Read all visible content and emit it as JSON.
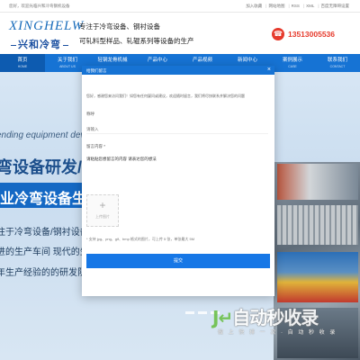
{
  "topbar": {
    "welcome": "您好，欢迎光临兴和冷弯钢机设备",
    "links": [
      "加入收藏",
      "网站地图",
      "RSS",
      "XML",
      "百度无障碍设置"
    ]
  },
  "header": {
    "logo_en": "XINGHELW",
    "logo_cn": "兴和冷弯",
    "slogan1": "专注于冷弯设备、钢衬设备",
    "slogan2": "可轧料型样品、轧辊系列等设备的生产",
    "phone": "13513005536",
    "phone_icon": "phone-icon"
  },
  "nav": [
    {
      "cn": "首页",
      "en": "HOME"
    },
    {
      "cn": "关于我们",
      "en": "ABOUT US"
    },
    {
      "cn": "轻钢龙骨机械",
      "en": ""
    },
    {
      "cn": "产品中心",
      "en": ""
    },
    {
      "cn": "产品视频",
      "en": ""
    },
    {
      "cn": "新闻中心",
      "en": ""
    },
    {
      "cn": "案例展示",
      "en": "CASE"
    },
    {
      "cn": "联系我们",
      "en": "CONTACT"
    }
  ],
  "banner": {
    "en_line": "ending equipment develo",
    "cn_big": "弯设备研发/",
    "cn_band": "业冷弯设备生产",
    "line3": "注于冷弯设备/钢衬设备/可",
    "line4": "进的生产车间 现代的生产设",
    "line5": "年生产经验的的研发队伍 拥"
  },
  "watermark": {
    "logo_cn": "自动秒收录",
    "sub": "做 上 快 排 一 次 · 自 动 秒 收 录"
  },
  "modal": {
    "title": "给我们留言",
    "close_icon": "close-icon",
    "desc": "您好，感谢您来访问我们！如您有任何疑问或建议，欢迎随时留言，我们将尽快联系并解决您的问题",
    "name_label": "称呼",
    "name_placeholder": "请输入",
    "message_label": "留言内容 *",
    "message_value": "请粘贴您想留言的内容\n请表达您的想法",
    "upload_label": "上传图片",
    "hint": "* 支持 jpg、png、gif、bmp 格式的图片，可上传 5 张，单张最大 5M",
    "submit": "提交"
  },
  "colors": {
    "nav_blue": "#1673d4",
    "accent_red": "#e63a2c",
    "submit_blue": "#1677e6"
  }
}
